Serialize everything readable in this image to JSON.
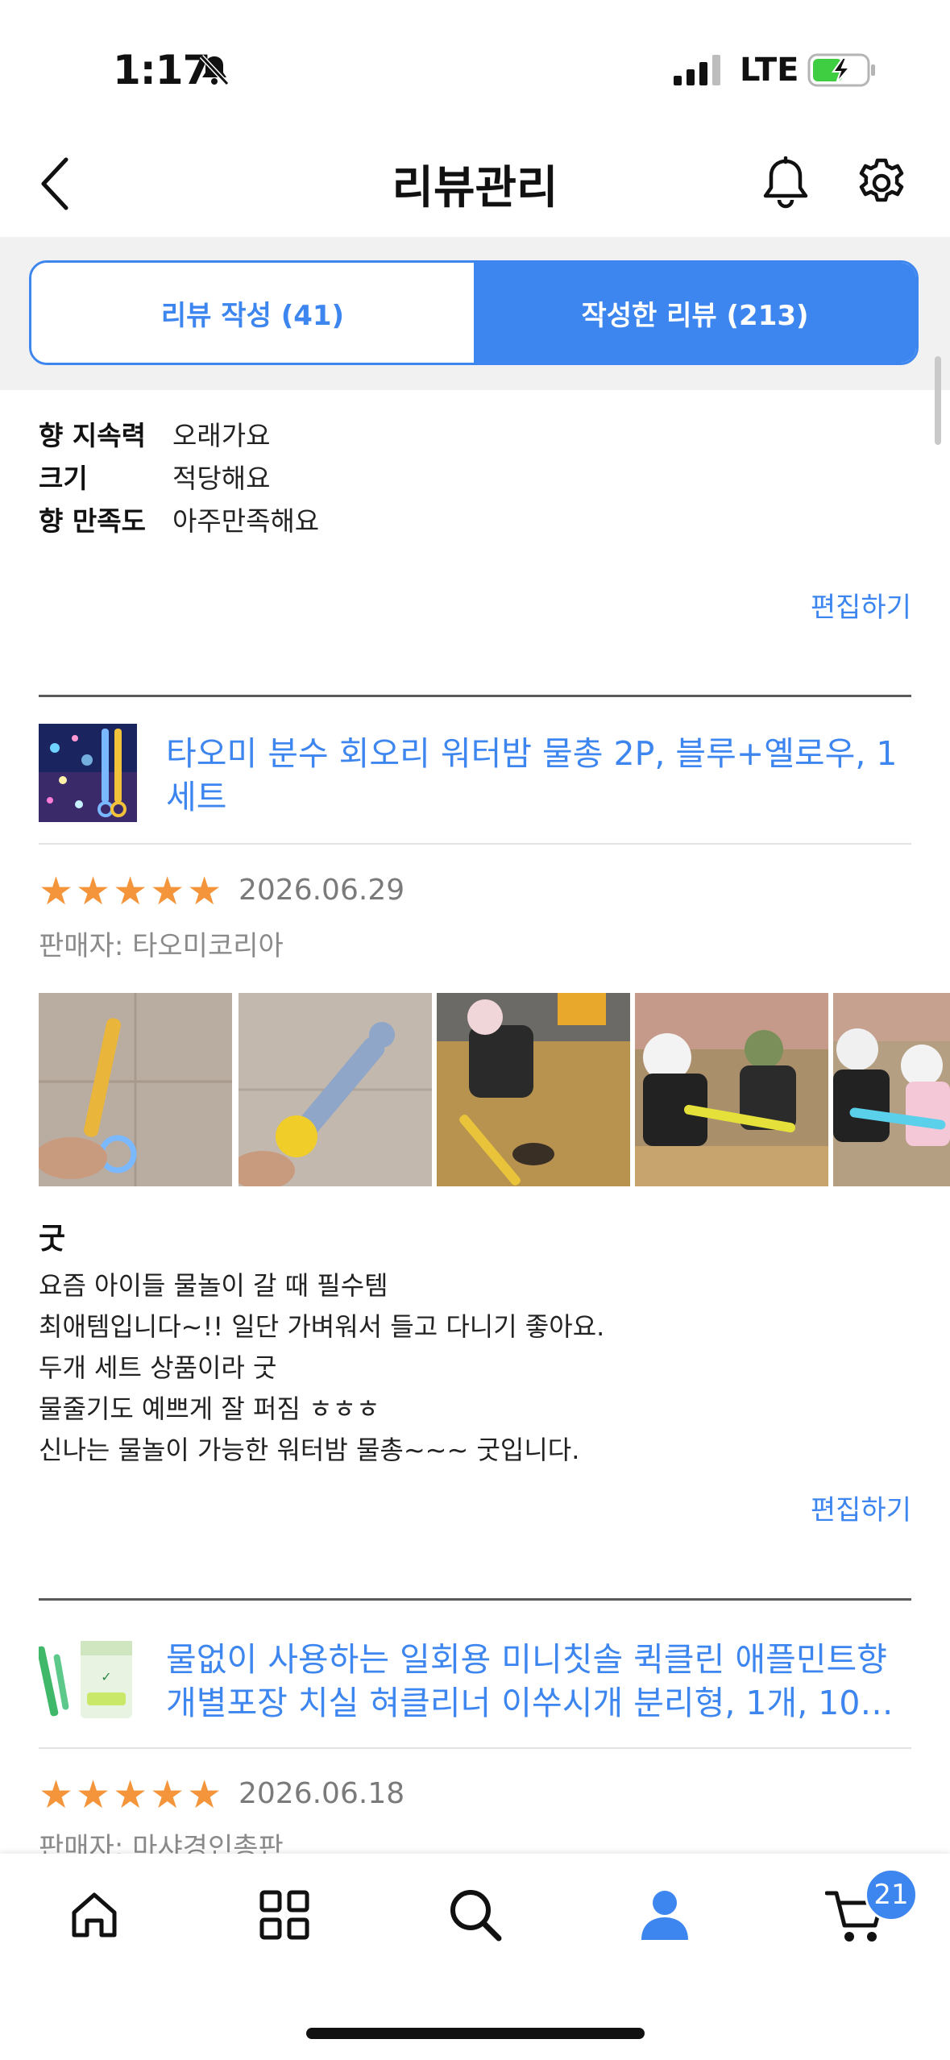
{
  "status_bar": {
    "time": "1:17",
    "network": "LTE"
  },
  "header": {
    "title": "리뷰관리"
  },
  "tabs": [
    {
      "label": "리뷰 작성 (41)",
      "active": false
    },
    {
      "label": "작성한 리뷰 (213)",
      "active": true
    }
  ],
  "prev_review": {
    "attributes": [
      {
        "label": "향 지속력",
        "value": "오래가요"
      },
      {
        "label": "크기",
        "value": "적당해요"
      },
      {
        "label": "향 만족도",
        "value": "아주만족해요"
      }
    ],
    "edit_label": "편집하기"
  },
  "review1": {
    "product_title": "타오미 분수 회오리 워터밤 물총 2P, 블루+옐로우, 1세트",
    "rating": 5,
    "date": "2026.06.29",
    "seller": "판매자: 타오미코리아",
    "review_title": "굿",
    "body_lines": [
      "요즘 아이들 물놀이 갈 때 필수템",
      "최애템입니다~!! 일단 가벼워서 들고 다니기 좋아요.",
      "두개 세트 상품이라 굿",
      "물줄기도 예쁘게 잘 퍼짐 ㅎㅎㅎ",
      "신나는 물놀이 가능한 워터밤 물총~~~ 굿입니다."
    ],
    "edit_label": "편집하기"
  },
  "review2": {
    "product_title_line1": "물없이 사용하는 일회용 미니칫솔 퀵클린 애플민트향",
    "product_title_line2": "개별포장 치실 혀클리너 이쑤시개 분리형, 1개, 10…",
    "rating": 5,
    "date": "2026.06.18",
    "seller": "판매자: 마샤경인총판"
  },
  "bottom_nav": {
    "items": [
      "home-icon",
      "categories-icon",
      "search-icon",
      "my-page-icon",
      "cart-icon"
    ],
    "cart_badge": "21"
  },
  "colors": {
    "accent": "#3d86ef",
    "star": "#f5953b"
  }
}
